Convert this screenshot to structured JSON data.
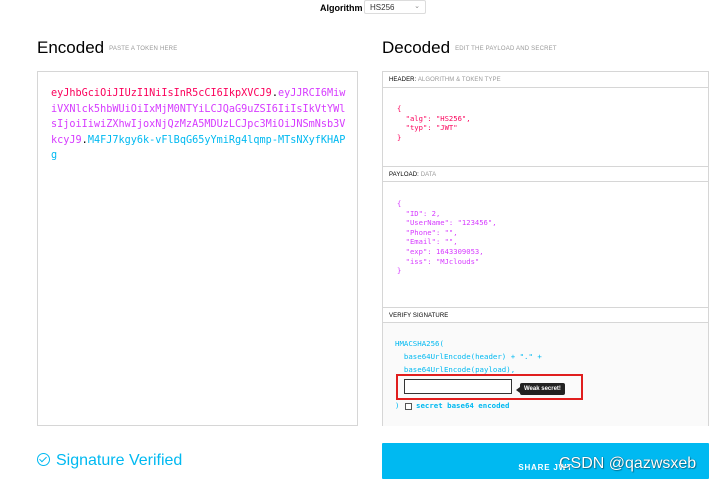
{
  "algorithm": {
    "label": "Algorithm",
    "selected": "HS256"
  },
  "encoded": {
    "title": "Encoded",
    "subtitle": "PASTE A TOKEN HERE",
    "token_header": "eyJhbGciOiJIUzI1NiIsInR5cCI6IkpXVCJ9",
    "token_payload": "eyJJRCI6MiwiVXNlck5hbWUiOiIxMjM0NTYiLCJQaG9uZSI6IiIsIkVtYWlsIjoiIiwiZXhwIjoxNjQzMzA5MDUzLCJpc3MiOiJNSmNsb3VkcyJ9",
    "token_signature": "M4FJ7kgy6k-vFlBqG65yYmiRg4lqmp-MTsNXyfKHAPg"
  },
  "decoded": {
    "title": "Decoded",
    "subtitle": "EDIT THE PAYLOAD AND SECRET",
    "header_section": {
      "label": "HEADER:",
      "sublabel": "ALGORITHM & TOKEN TYPE"
    },
    "header_json": "{\n  \"alg\": \"HS256\",\n  \"typ\": \"JWT\"\n}",
    "payload_section": {
      "label": "PAYLOAD:",
      "sublabel": "DATA"
    },
    "payload_json": "{\n  \"ID\": 2,\n  \"UserName\": \"123456\",\n  \"Phone\": \"\",\n  \"Email\": \"\",\n  \"exp\": 1643309053,\n  \"iss\": \"MJclouds\"\n}",
    "signature_section": {
      "label": "VERIFY SIGNATURE"
    },
    "sig_line1": "HMACSHA256(",
    "sig_line2": "  base64UrlEncode(header) + \".\" +",
    "sig_line3": "  base64UrlEncode(payload),",
    "secret_value": "",
    "weak_secret_tooltip": "Weak secret!",
    "sig_close": ")",
    "secret_base64_label": "secret base64 encoded"
  },
  "footer": {
    "verified_text": "Signature Verified",
    "share_label": "SHARE JWT"
  },
  "watermark": "CSDN @qazwsxeb",
  "colors": {
    "header": "#fb015b",
    "payload": "#d63aff",
    "signature": "#00b9f1",
    "highlight": "#e01e1e"
  }
}
